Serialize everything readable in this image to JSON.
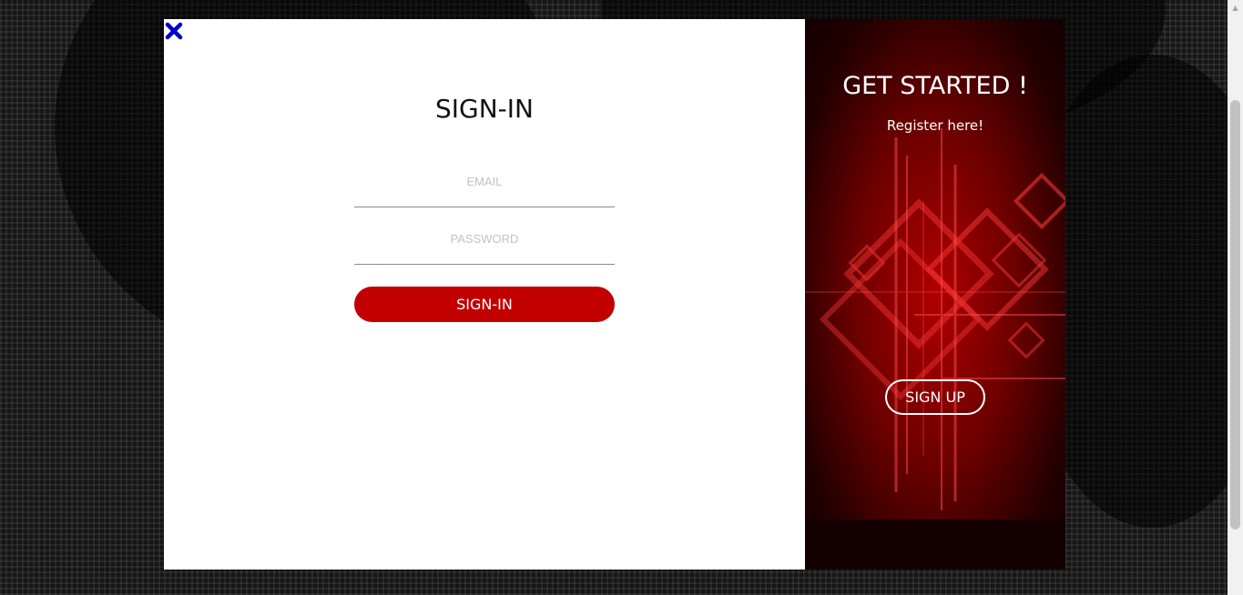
{
  "icons": {
    "close": "close-icon"
  },
  "colors": {
    "close_icon": "#0000cc",
    "primary_button": "#c20000",
    "panel_dark": "#120000"
  },
  "signin": {
    "title": "SIGN-IN",
    "email_placeholder": "EMAIL",
    "email_value": "",
    "password_placeholder": "PASSWORD",
    "password_value": "",
    "button_label": "SIGN-IN"
  },
  "register_panel": {
    "heading": "GET STARTED !",
    "subheading": "Register here!",
    "button_label": "SIGN UP"
  }
}
